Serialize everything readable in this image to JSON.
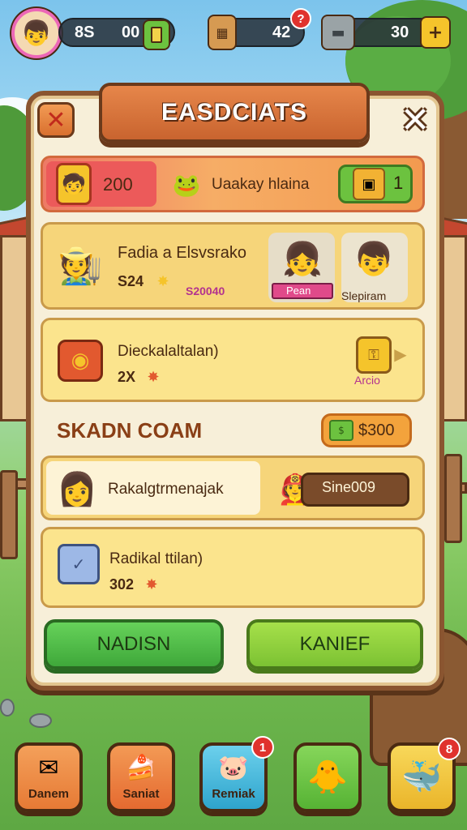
{
  "header": {
    "player_avatar_icon": "boy-avatar-icon",
    "resources": [
      {
        "value_a": "8S",
        "value_b": "00",
        "icon": "card-icon"
      },
      {
        "value": "42",
        "icon": "crate-icon",
        "badge": "?"
      },
      {
        "value": "30",
        "icon": "anvil-icon",
        "plus_icon": "plus-icon"
      }
    ]
  },
  "panel": {
    "title": "EASDCIATS",
    "close_label": "✕",
    "rows": [
      {
        "id": "row1",
        "value": "200",
        "name": "Uaakay hlaina",
        "count": "1"
      },
      {
        "id": "row2",
        "title": "Fadia a Elsvsrako",
        "amount": "S24",
        "price": "S20040",
        "portrait_a_label": "Pean",
        "portrait_b_label": "Slepiram"
      },
      {
        "id": "row3",
        "title": "Dieckalaltalan)",
        "amount": "2X",
        "chest_label": "Arcio"
      }
    ],
    "section_title": "SKADN COAM",
    "section_price": "$300",
    "rows2": [
      {
        "id": "row4",
        "name": "Rakalgtrmenajak",
        "value": "Sine009"
      },
      {
        "id": "row5",
        "title": "Radikal ttilan)",
        "amount": "302"
      }
    ],
    "buttons": {
      "left_label": "NADISN",
      "right_label": "KANIEF"
    }
  },
  "nav": [
    {
      "label": "Danem",
      "icon": "envelope-icon",
      "color": "#ef8a3c"
    },
    {
      "label": "Saniat",
      "icon": "cake-icon",
      "color": "#ee7a3a"
    },
    {
      "label": "Remiak",
      "icon": "pig-icon",
      "color": "#3fb6d8",
      "badge": "1"
    },
    {
      "label": "",
      "icon": "chick-icon",
      "color": "#6cc23f"
    },
    {
      "label": "",
      "icon": "creature-icon",
      "color": "#f2c53a",
      "badge": "8"
    }
  ],
  "colors": {
    "panel_bg": "#f7efd9",
    "frame": "#8a5530",
    "green_button": "#52c04a",
    "lime_button": "#8fd13a",
    "red_highlight": "#ec5a5a"
  }
}
